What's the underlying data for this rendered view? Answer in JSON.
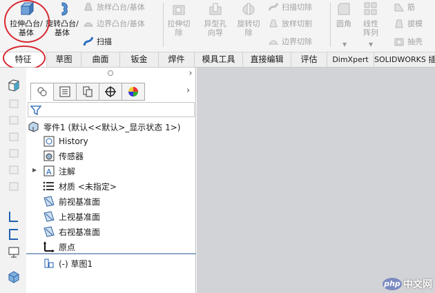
{
  "ribbon": {
    "extrude_boss": "拉伸凸台/基体",
    "revolve_boss": "旋转凸台/基体",
    "loft_boss": "放样凸台/基体",
    "boundary_boss": "边界凸台/基体",
    "sweep": "扫描",
    "extrude_cut": "拉伸切除",
    "hole_wizard": "异型孔向导",
    "revolve_cut": "旋转切除",
    "swept_cut": "扫描切除",
    "lofted_cut": "放样切割",
    "boundary_cut": "边界切除",
    "fillet": "圆角",
    "linear_pattern": "线性阵列",
    "rib": "筋",
    "draft": "拔模",
    "shell": "抽壳"
  },
  "tabs": [
    "特征",
    "草图",
    "曲面",
    "钣金",
    "焊件",
    "模具工具",
    "直接编辑",
    "评估",
    "DimXpert",
    "SOLIDWORKS 插"
  ],
  "feature_tree": {
    "root": "零件1 (默认<<默认>_显示状态 1>)",
    "items": [
      "History",
      "传感器",
      "注解",
      "材质 <未指定>",
      "前视基准面",
      "上视基准面",
      "右视基准面",
      "原点"
    ],
    "sketch": "(-) 草图1"
  },
  "watermark": {
    "badge": "php",
    "text": "中文网"
  },
  "colors": {
    "annotation_red": "#d8262f",
    "graphics_bg": "#d2d3d6",
    "ribbon_bg": "#f4f4f4"
  }
}
